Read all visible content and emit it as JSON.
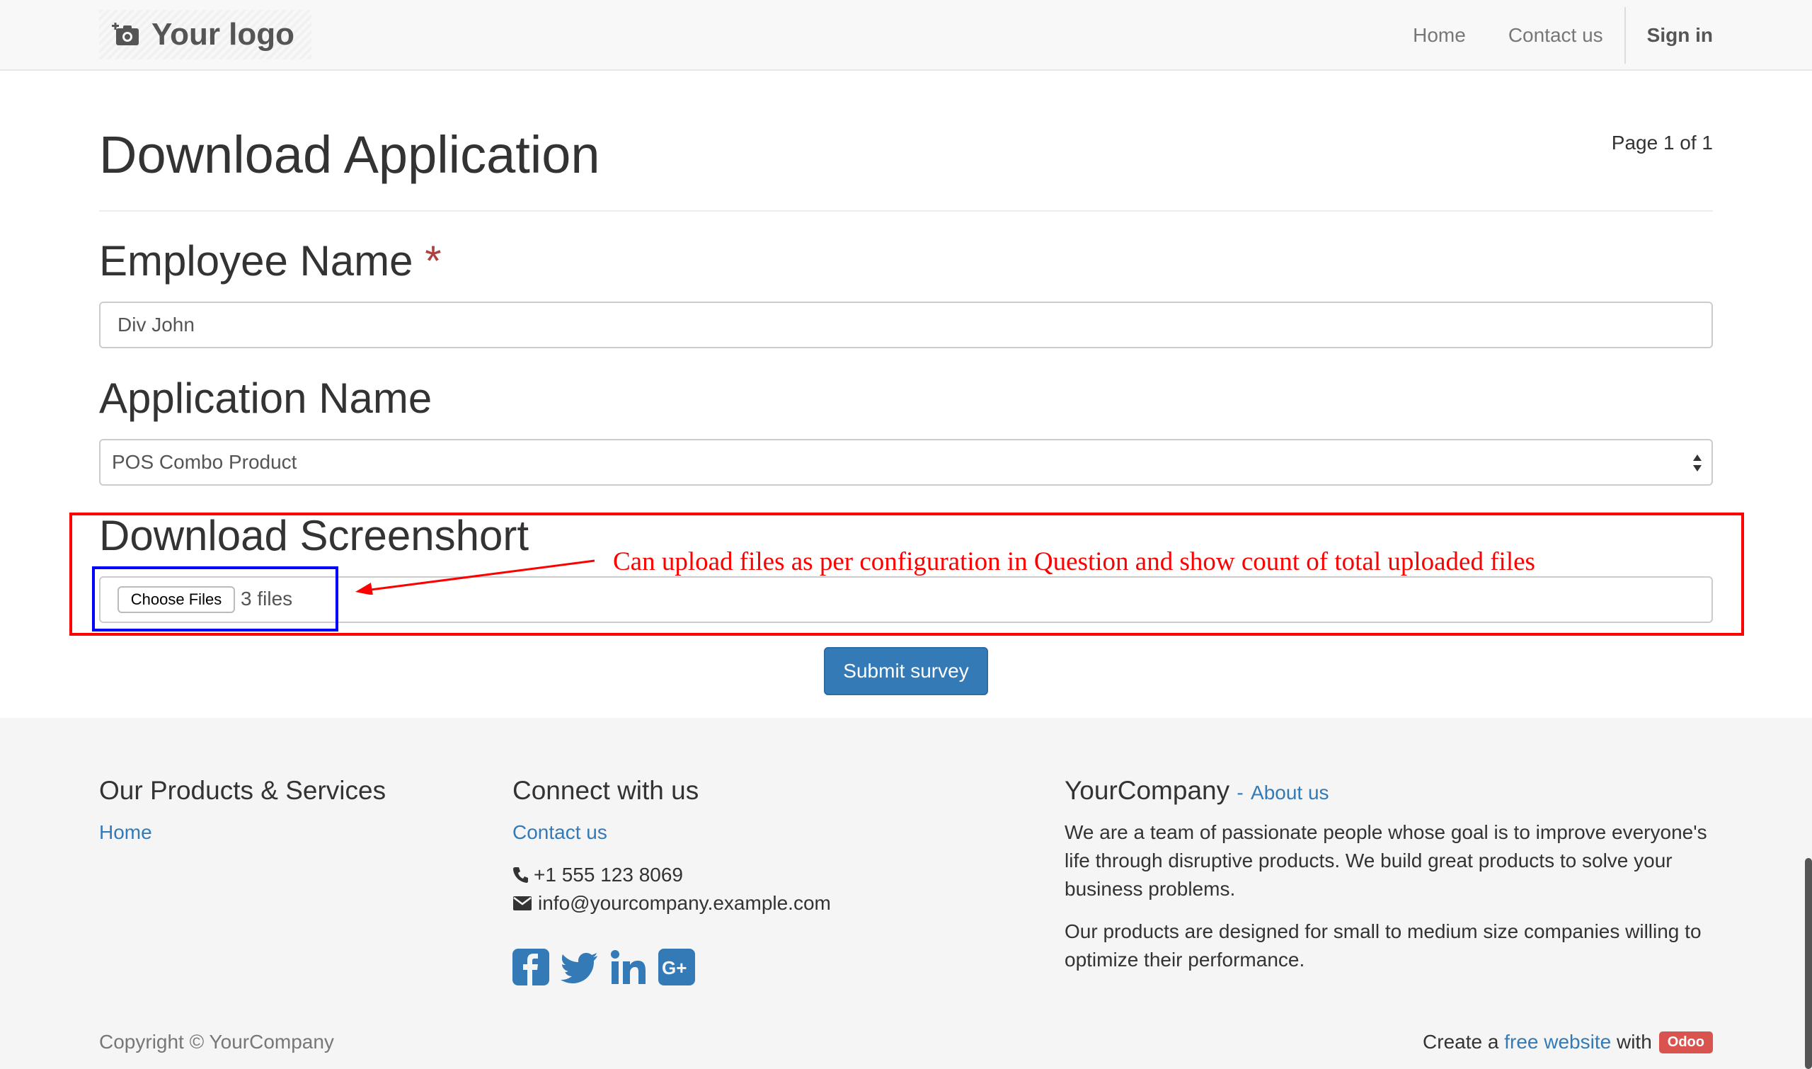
{
  "navbar": {
    "brand": "Your logo",
    "brand_icon": "camera-plus-icon",
    "items": [
      {
        "label": "Home"
      },
      {
        "label": "Contact us"
      }
    ],
    "signin": "Sign in"
  },
  "survey": {
    "title": "Download Application",
    "page_counter": "Page 1 of 1",
    "questions": {
      "employee_name": {
        "label": "Employee Name",
        "required_mark": "*",
        "value": "Div John"
      },
      "application_name": {
        "label": "Application Name",
        "selected": "POS Combo Product"
      },
      "screenshot": {
        "label": "Download Screenshort",
        "button": "Choose Files",
        "count": "3 files"
      }
    },
    "submit": "Submit survey"
  },
  "annotation": {
    "text": "Can upload files as per configuration in Question and show count of total uploaded files",
    "box_color": "#ff0000",
    "highlight_color": "#0000ff"
  },
  "footer": {
    "col1": {
      "title": "Our Products & Services",
      "link": "Home"
    },
    "col2": {
      "title": "Connect with us",
      "link": "Contact us",
      "phone": "+1 555 123 8069",
      "email": "info@yourcompany.example.com",
      "social": [
        "facebook-icon",
        "twitter-icon",
        "linkedin-icon",
        "google-plus-icon"
      ]
    },
    "col3": {
      "title": "YourCompany",
      "dash": "-",
      "link": "About us",
      "p1": "We are a team of passionate people whose goal is to improve everyone's life through disruptive products. We build great products to solve your business problems.",
      "p2": "Our products are designed for small to medium size companies willing to optimize their performance."
    },
    "copyright": "Copyright © YourCompany",
    "credit_prefix": "Create a",
    "credit_link": "free website",
    "credit_with": "with",
    "credit_badge": "Odoo"
  },
  "colors": {
    "primary": "#337ab7",
    "required": "#a94442",
    "badge": "#d9534f"
  }
}
